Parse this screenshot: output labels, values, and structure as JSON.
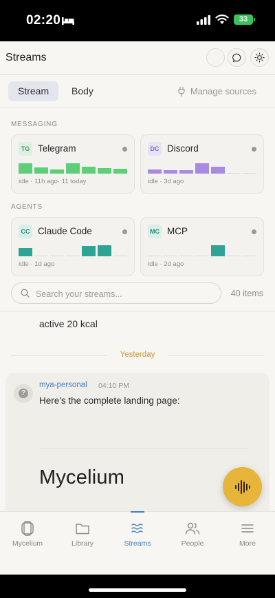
{
  "status_bar": {
    "time": "02:20",
    "battery": "33"
  },
  "header": {
    "title": "Streams"
  },
  "tabs": {
    "stream": "Stream",
    "body": "Body",
    "manage": "Manage sources"
  },
  "sections": {
    "messaging": {
      "label": "MESSAGING",
      "cards": [
        {
          "badge": "TG",
          "name": "Telegram",
          "meta": "idle · 11h ago· 11 today",
          "color": "#5fce7a",
          "levels": [
            0.8,
            0.45,
            0.3,
            0.8,
            0.55,
            0.4,
            0.35
          ]
        },
        {
          "badge": "DC",
          "name": "Discord",
          "meta": "idle · 3d ago",
          "color": "#a88be0",
          "levels": [
            0.3,
            0.25,
            0.25,
            0.8,
            0.5,
            0,
            0
          ]
        }
      ]
    },
    "agents": {
      "label": "AGENTS",
      "cards": [
        {
          "badge": "CC",
          "name": "Claude Code",
          "meta": "idle · 1d ago",
          "color": "#2fa394",
          "levels": [
            0.65,
            0,
            0,
            0,
            0.8,
            0.85,
            0
          ]
        },
        {
          "badge": "MC",
          "name": "MCP",
          "meta": "idle · 2d ago",
          "color": "#2fa394",
          "levels": [
            0,
            0,
            0,
            0,
            0.85,
            0,
            0
          ]
        }
      ]
    }
  },
  "search": {
    "placeholder": "Search your streams...",
    "count": "40 items"
  },
  "feed": {
    "previous_text": "active 20 kcal",
    "divider": "Yesterday",
    "message": {
      "author": "mya-personal",
      "time": "04:10 PM",
      "body": "Here's the complete landing page:",
      "heading": "Mycelium"
    }
  },
  "nav": [
    {
      "label": "Mycelium",
      "icon": "mycelium-icon"
    },
    {
      "label": "Library",
      "icon": "folder-icon"
    },
    {
      "label": "Streams",
      "icon": "waves-icon",
      "active": true
    },
    {
      "label": "People",
      "icon": "people-icon"
    },
    {
      "label": "More",
      "icon": "menu-icon"
    }
  ],
  "colors": {
    "accent": "#3f7fc1",
    "fab": "#e8b53b",
    "divider_label": "#c39a3c",
    "background": "#f7f6f2"
  }
}
